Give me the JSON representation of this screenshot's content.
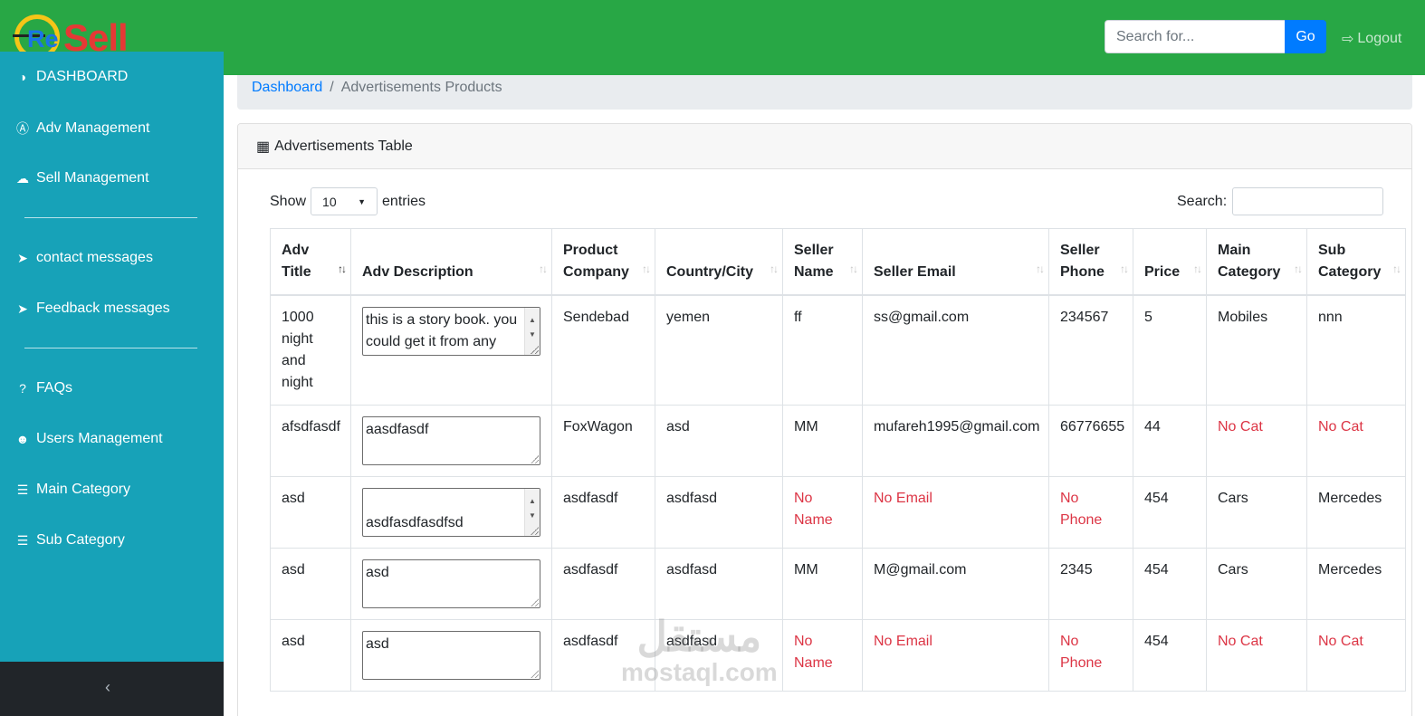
{
  "brand": {
    "logo_re": "Re",
    "logo_sell": "Sell"
  },
  "topbar": {
    "search_placeholder": "Search for...",
    "go_label": "Go",
    "logout_label": "Logout",
    "logout_icon": "sign-out-icon"
  },
  "sidebar": {
    "items": [
      {
        "label": "DASHBOARD",
        "icon": "tachometer-icon"
      },
      {
        "label": "Adv Management",
        "icon": "badge-a-icon"
      },
      {
        "label": "Sell Management",
        "icon": "cloud-upload-icon"
      },
      {
        "label": "contact messages",
        "icon": "paper-plane-icon"
      },
      {
        "label": "Feedback messages",
        "icon": "paper-plane-icon"
      },
      {
        "label": "FAQs",
        "icon": "question-icon"
      },
      {
        "label": "Users Management",
        "icon": "users-icon"
      },
      {
        "label": "Main Category",
        "icon": "list-icon"
      },
      {
        "label": "Sub Category",
        "icon": "list-icon"
      }
    ],
    "collapse_icon": "chevron-left-icon"
  },
  "breadcrumb": {
    "home": "Dashboard",
    "separator": "/",
    "current": "Advertisements Products"
  },
  "card": {
    "title": "Advertisements Table",
    "icon": "table-icon"
  },
  "datatable": {
    "show_label": "Show",
    "entries_value": "10",
    "entries_label": "entries",
    "search_label": "Search:",
    "columns": [
      "Adv Title",
      "Adv Description",
      "Product Company",
      "Country/City",
      "Seller Name",
      "Seller Email",
      "Seller Phone",
      "Price",
      "Main Category",
      "Sub Category"
    ],
    "rows": [
      {
        "title": "1000 night and night",
        "description": "this is a story book. you could get it from any",
        "company": "Sendebad",
        "country": "yemen",
        "seller_name": "ff",
        "seller_email": "ss@gmail.com",
        "seller_phone": "234567",
        "price": "5",
        "main_category": "Mobiles",
        "sub_category": "nnn"
      },
      {
        "title": "afsdfasdf",
        "description": "aasdfasdf",
        "company": "FoxWagon",
        "country": "asd",
        "seller_name": "MM",
        "seller_email": "mufareh1995@gmail.com",
        "seller_phone": "66776655",
        "price": "44",
        "main_category": "No Cat",
        "sub_category": "No Cat"
      },
      {
        "title": "asd",
        "description": "asdfasdfasdfsd\nf",
        "company": "asdfasdf",
        "country": "asdfasd",
        "seller_name": "No Name",
        "seller_email": "No Email",
        "seller_phone": "No Phone",
        "price": "454",
        "main_category": "Cars",
        "sub_category": "Mercedes"
      },
      {
        "title": "asd",
        "description": "asd",
        "company": "asdfasdf",
        "country": "asdfasd",
        "seller_name": "MM",
        "seller_email": "M@gmail.com",
        "seller_phone": "2345",
        "price": "454",
        "main_category": "Cars",
        "sub_category": "Mercedes"
      },
      {
        "title": "asd",
        "description": "asd",
        "company": "asdfasdf",
        "country": "asdfasd",
        "seller_name": "No Name",
        "seller_email": "No Email",
        "seller_phone": "No Phone",
        "price": "454",
        "main_category": "No Cat",
        "sub_category": "No Cat"
      }
    ]
  },
  "watermark": {
    "arabic": "مستقل",
    "latin": "mostaql.com"
  },
  "colors": {
    "topbar": "#28a745",
    "sidebar": "#17a2b8",
    "sidebar_footer": "#212529",
    "link": "#007bff",
    "missing_value": "#dc3545"
  }
}
